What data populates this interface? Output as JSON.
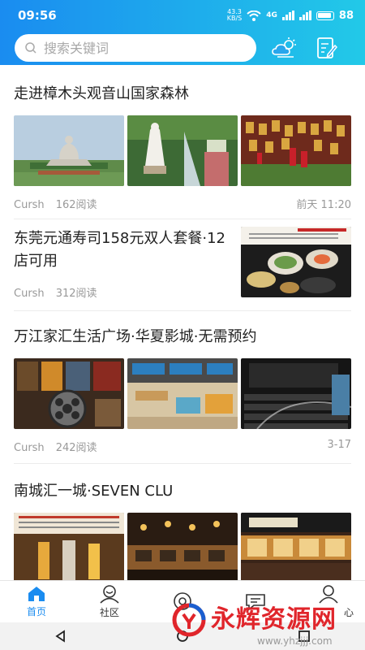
{
  "status": {
    "time": "09:56",
    "speed_value": "43.3",
    "speed_unit": "KB/S",
    "net": "4G",
    "battery": "88"
  },
  "search": {
    "placeholder": "搜索关键词"
  },
  "header": {
    "weather_icon": "cloud-sun-icon",
    "edit_icon": "edit-note-icon"
  },
  "articles": [
    {
      "title": "走进樟木头观音山国家森林",
      "author": "Cursh",
      "reads": "162阅读",
      "time": "前天 11:20"
    },
    {
      "title": "东莞元通寿司158元双人套餐·12店可用",
      "author": "Cursh",
      "reads": "312阅读",
      "time": ""
    },
    {
      "title": "万江家汇生活广场·华夏影城·无需预约",
      "author": "Cursh",
      "reads": "242阅读",
      "time": "3-17"
    },
    {
      "title": "南城汇一城·SEVEN CLU",
      "author": "",
      "reads": "",
      "time": ""
    }
  ],
  "tabs": [
    {
      "label": "首页",
      "icon": "home-icon",
      "active": true
    },
    {
      "label": "社区",
      "icon": "community-icon",
      "active": false
    },
    {
      "label": "",
      "icon": "eye-icon",
      "active": false
    },
    {
      "label": "",
      "icon": "message-icon",
      "active": false
    },
    {
      "label": "心",
      "icon": "user-icon",
      "active": false
    }
  ],
  "watermark": {
    "text": "永辉资源网",
    "url": "www.yhzjjj.com"
  },
  "colors": {
    "brand_start": "#1a8cf0",
    "brand_end": "#22c9e8",
    "watermark": "#e0252b"
  }
}
